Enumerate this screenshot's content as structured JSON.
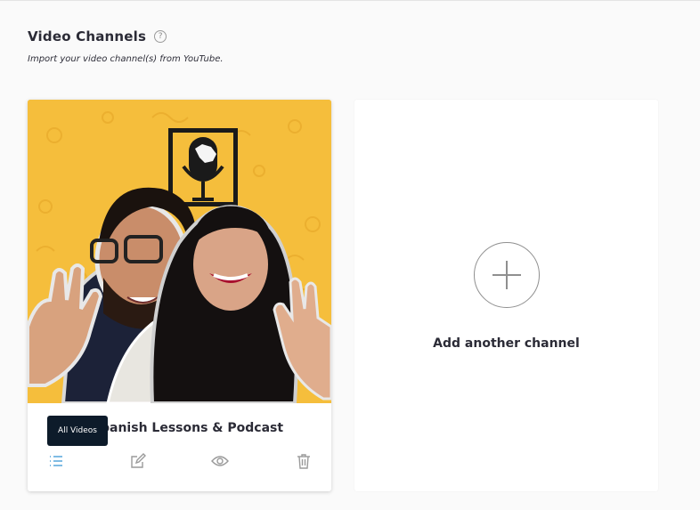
{
  "page": {
    "title": "Video Channels",
    "help_icon": "question-circle-icon",
    "subtitle": "Import your video channel(s) from YouTube."
  },
  "channel_card": {
    "name_visible": "panish Lessons & Podcast",
    "tooltip": "All Videos",
    "thumbnail": "channel-thumbnail-image",
    "actions": [
      {
        "name": "list-icon",
        "tooltip": "All Videos"
      },
      {
        "name": "edit-icon"
      },
      {
        "name": "eye-icon"
      },
      {
        "name": "trash-icon"
      }
    ],
    "colors": {
      "thumbnail_bg": "#f5be3c",
      "tooltip_bg": "#0d1b2a",
      "active_icon": "#4a9fd8",
      "icon": "#9a9a9a"
    }
  },
  "add_card": {
    "label": "Add another channel",
    "icon": "plus-circle-icon"
  }
}
